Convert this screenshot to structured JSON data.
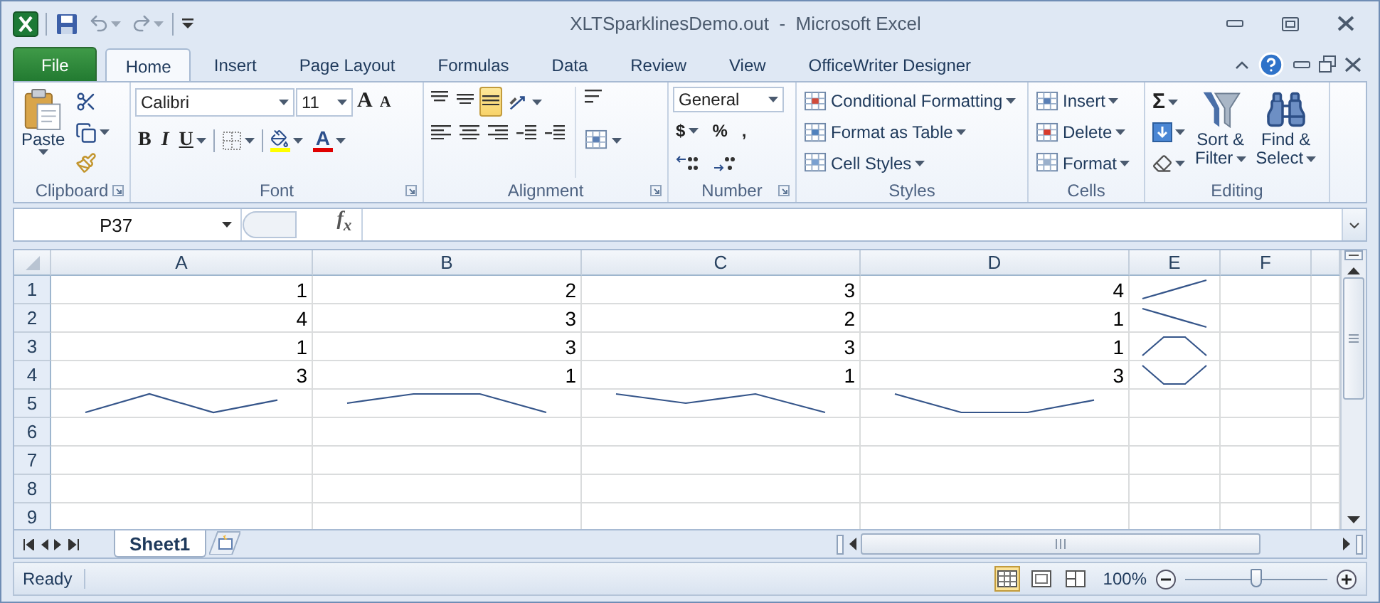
{
  "window": {
    "title": "XLTSparklinesDemo.out  -  Microsoft Excel"
  },
  "tabs": [
    {
      "label": "File",
      "kind": "file",
      "selected": false
    },
    {
      "label": "Home",
      "kind": "tab",
      "selected": true
    },
    {
      "label": "Insert",
      "kind": "tab",
      "selected": false
    },
    {
      "label": "Page Layout",
      "kind": "tab",
      "selected": false
    },
    {
      "label": "Formulas",
      "kind": "tab",
      "selected": false
    },
    {
      "label": "Data",
      "kind": "tab",
      "selected": false
    },
    {
      "label": "Review",
      "kind": "tab",
      "selected": false
    },
    {
      "label": "View",
      "kind": "tab",
      "selected": false
    },
    {
      "label": "OfficeWriter Designer",
      "kind": "tab",
      "selected": false
    }
  ],
  "ribbon": {
    "clipboard": {
      "label": "Clipboard",
      "paste": "Paste"
    },
    "font": {
      "label": "Font",
      "name": "Calibri",
      "size": "11",
      "grow": "A",
      "shrink": "A",
      "styles": [
        "B",
        "I",
        "U"
      ],
      "font_color_letter": "A"
    },
    "alignment": {
      "label": "Alignment",
      "vertical": [
        {
          "selected": false
        },
        {
          "selected": false
        },
        {
          "selected": true
        }
      ]
    },
    "number": {
      "label": "Number",
      "format": "General",
      "symbols": [
        "$",
        "%",
        ","
      ]
    },
    "styles": {
      "label": "Styles",
      "items": [
        "Conditional Formatting",
        "Format as Table",
        "Cell Styles"
      ]
    },
    "cells": {
      "label": "Cells",
      "items": [
        "Insert",
        "Delete",
        "Format"
      ]
    },
    "editing": {
      "label": "Editing",
      "sum": "Σ",
      "sort": [
        "Sort &",
        "Filter"
      ],
      "find": [
        "Find &",
        "Select"
      ]
    }
  },
  "formula_bar": {
    "name_box": "P37",
    "fx": "f$_{x}$"
  },
  "sheet": {
    "columns": [
      "A",
      "B",
      "C",
      "D",
      "E",
      "F"
    ],
    "rows": [
      {
        "header": "1",
        "cells": [
          {
            "kind": "number",
            "text": "1"
          },
          {
            "kind": "number",
            "text": "2"
          },
          {
            "kind": "number",
            "text": "3"
          },
          {
            "kind": "number",
            "text": "4"
          },
          {
            "kind": "sparkline"
          }
        ]
      },
      {
        "header": "2",
        "cells": [
          {
            "kind": "number",
            "text": "4"
          },
          {
            "kind": "number",
            "text": "3"
          },
          {
            "kind": "number",
            "text": "2"
          },
          {
            "kind": "number",
            "text": "1"
          },
          {
            "kind": "sparkline"
          }
        ]
      },
      {
        "header": "3",
        "cells": [
          {
            "kind": "number",
            "text": "1"
          },
          {
            "kind": "number",
            "text": "3"
          },
          {
            "kind": "number",
            "text": "3"
          },
          {
            "kind": "number",
            "text": "1"
          },
          {
            "kind": "sparkline"
          }
        ]
      },
      {
        "header": "4",
        "cells": [
          {
            "kind": "number",
            "text": "3"
          },
          {
            "kind": "number",
            "text": "1"
          },
          {
            "kind": "number",
            "text": "1"
          },
          {
            "kind": "number",
            "text": "3"
          },
          {
            "kind": "sparkline"
          }
        ]
      },
      {
        "header": "5",
        "cells": [
          {
            "kind": "sparkline"
          },
          {
            "kind": "sparkline"
          },
          {
            "kind": "sparkline"
          },
          {
            "kind": "sparkline"
          }
        ]
      },
      {
        "header": "6",
        "cells": []
      },
      {
        "header": "7",
        "cells": []
      },
      {
        "header": "8",
        "cells": []
      },
      {
        "header": "9",
        "cells": []
      }
    ]
  },
  "sheet_tabs": [
    {
      "label": "Sheet1",
      "selected": true
    }
  ],
  "status_bar": {
    "status": "Ready",
    "views": [
      {
        "selected": true
      },
      {
        "selected": false
      },
      {
        "selected": false
      }
    ],
    "zoom": "100%",
    "level": 0.5
  }
}
